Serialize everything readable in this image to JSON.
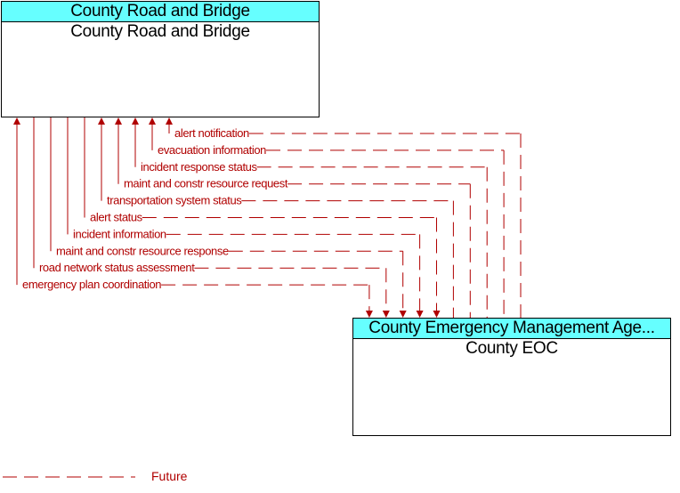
{
  "colors": {
    "flow": "#b00000",
    "header_fill": "#66ffff",
    "border": "#000000"
  },
  "elements": {
    "top": {
      "header": "County Road and Bridge",
      "name": "County Road and Bridge"
    },
    "bottom": {
      "header": "County Emergency Management Age...",
      "name": "County EOC"
    }
  },
  "flows": [
    {
      "label": "alert notification",
      "to": "top",
      "status": "Future"
    },
    {
      "label": "evacuation information",
      "to": "top",
      "status": "Future"
    },
    {
      "label": "incident response status",
      "to": "top",
      "status": "Future"
    },
    {
      "label": "maint and constr resource request",
      "to": "top",
      "status": "Future"
    },
    {
      "label": "transportation system status",
      "to": "top",
      "status": "Future"
    },
    {
      "label": "alert status",
      "to": "bottom",
      "status": "Future"
    },
    {
      "label": "incident information",
      "to": "bottom",
      "status": "Future"
    },
    {
      "label": "maint and constr resource response",
      "to": "bottom",
      "status": "Future"
    },
    {
      "label": "road network status assessment",
      "to": "bottom",
      "status": "Future"
    },
    {
      "label": "emergency plan coordination",
      "to": "both",
      "status": "Future"
    }
  ],
  "legend": {
    "label": "Future"
  }
}
